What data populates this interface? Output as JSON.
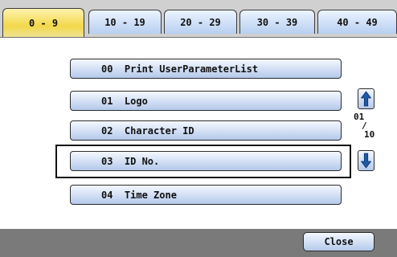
{
  "tabs": [
    {
      "label": "0 - 9",
      "active": true
    },
    {
      "label": "10 - 19",
      "active": false
    },
    {
      "label": "20 - 29",
      "active": false
    },
    {
      "label": "30 - 39",
      "active": false
    },
    {
      "label": "40 - 49",
      "active": false
    }
  ],
  "items": [
    {
      "label": "00  Print UserParameterList"
    },
    {
      "label": "01  Logo"
    },
    {
      "label": "02  Character ID"
    },
    {
      "label": "03  ID No.",
      "selected": true
    },
    {
      "label": "04  Time Zone"
    }
  ],
  "page_indicator": {
    "current": "01",
    "separator": "/",
    "total": "10"
  },
  "footer": {
    "close_label": "Close"
  },
  "colors": {
    "tab_active": "#f2d84a",
    "button": "#b4c9ea",
    "arrow": "#1f5aa8"
  },
  "icons": {
    "up": "arrow-up-icon",
    "down": "arrow-down-icon"
  }
}
